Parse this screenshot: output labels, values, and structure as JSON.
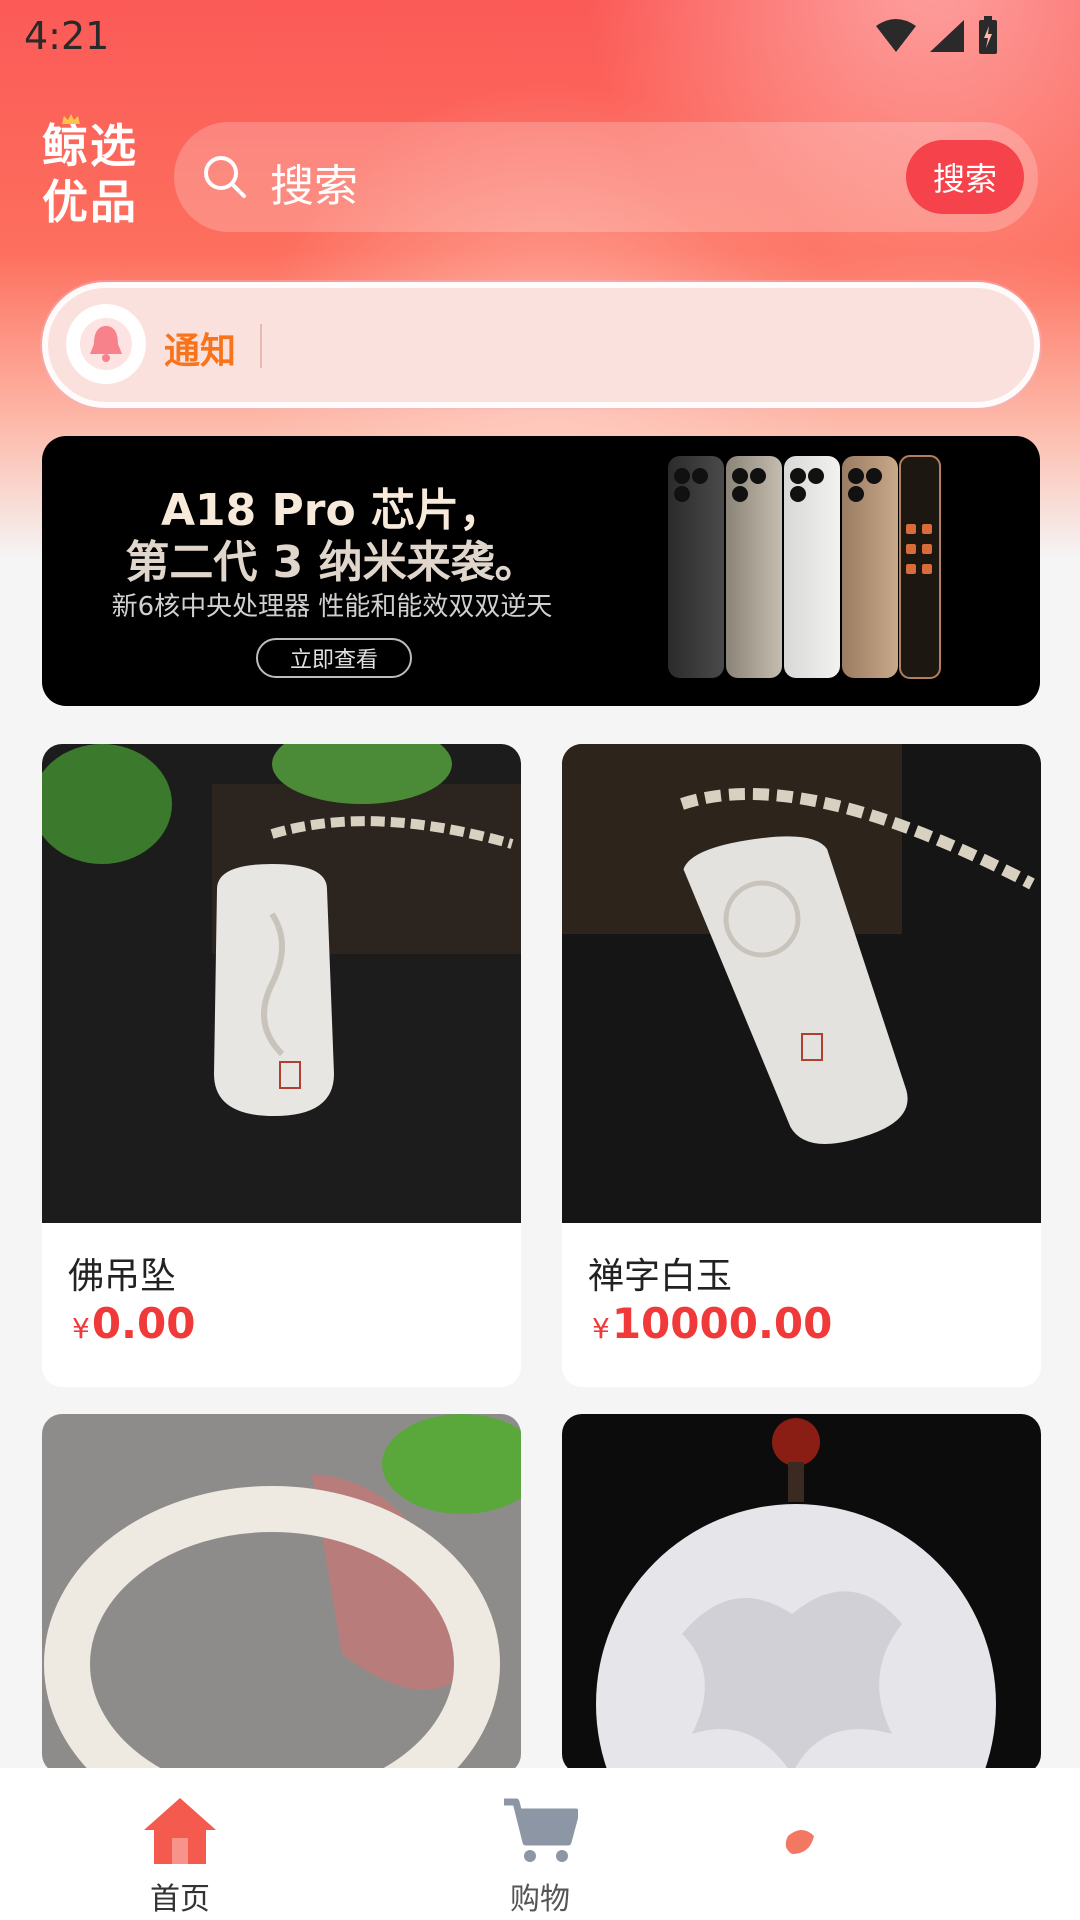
{
  "status_bar": {
    "time": "4:21"
  },
  "header": {
    "logo_line1": "鲸选",
    "logo_line2": "优品",
    "search_placeholder": "搜索",
    "search_button": "搜索"
  },
  "notice": {
    "label": "通知"
  },
  "banner": {
    "headline1": "A18 Pro 芯片，",
    "headline2": "第二代 3 纳米来袭。",
    "subtitle": "新6核中央处理器 性能和能效双双逆天",
    "cta": "立即查看"
  },
  "products": [
    {
      "name": "佛吊坠",
      "currency": "¥",
      "price": "0.00"
    },
    {
      "name": "禅字白玉",
      "currency": "¥",
      "price": "10000.00"
    },
    {
      "name": "",
      "currency": "",
      "price": ""
    },
    {
      "name": "",
      "currency": "",
      "price": ""
    }
  ],
  "tabbar": {
    "items": [
      {
        "label": "首页"
      },
      {
        "label": "购物"
      }
    ]
  },
  "colors": {
    "accent": "#f6424b",
    "price": "#f03a3a",
    "notice_label": "#f7741d",
    "header_gradient_top": "#fb5a57"
  },
  "icons": [
    "search-icon",
    "bell-icon",
    "home-icon",
    "cart-icon",
    "wifi-icon",
    "signal-icon",
    "battery-icon"
  ]
}
